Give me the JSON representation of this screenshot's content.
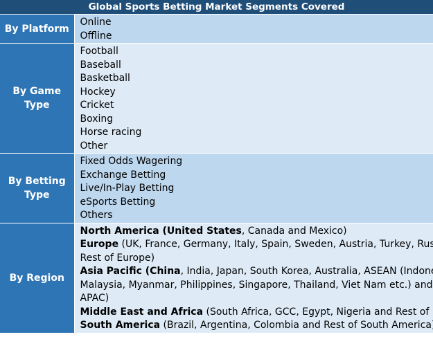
{
  "title": "Global Sports Betting Market Segments Covered",
  "segments": {
    "platform": {
      "label": "By Platform",
      "items": [
        "Online",
        "Offline"
      ]
    },
    "game": {
      "label": "By Game Type",
      "items": [
        "Football",
        "Baseball",
        "Basketball",
        "Hockey",
        "Cricket",
        "Boxing",
        "Horse racing",
        "Other"
      ]
    },
    "betting": {
      "label": "By Betting Type",
      "items": [
        "Fixed Odds Wagering",
        "Exchange Betting",
        "Live/In-Play Betting",
        "eSports Betting",
        "Others"
      ]
    },
    "region": {
      "label": "By Region",
      "lines": [
        {
          "bold": "North America (United States",
          "rest": ", Canada and Mexico)"
        },
        {
          "bold": "Europe",
          "rest": " (UK, France, Germany, Italy, Spain, Sweden, Austria, Turkey, Russia and"
        },
        {
          "bold": "",
          "rest": "Rest of Europe)"
        },
        {
          "bold": "Asia Pacific (China",
          "rest": ", India, Japan, South Korea, Australia, ASEAN (Indonesia,"
        },
        {
          "bold": "",
          "rest": "Malaysia, Myanmar, Philippines, Singapore, Thailand, Viet Nam etc.) and Rest of"
        },
        {
          "bold": "",
          "rest": "APAC)"
        },
        {
          "bold": "Middle East and Africa",
          "rest": " (South Africa, GCC, Egypt, Nigeria and Rest of ME&A)"
        },
        {
          "bold": "South America",
          "rest": " (Brazil, Argentina, Colombia and Rest of South America)"
        }
      ]
    }
  }
}
